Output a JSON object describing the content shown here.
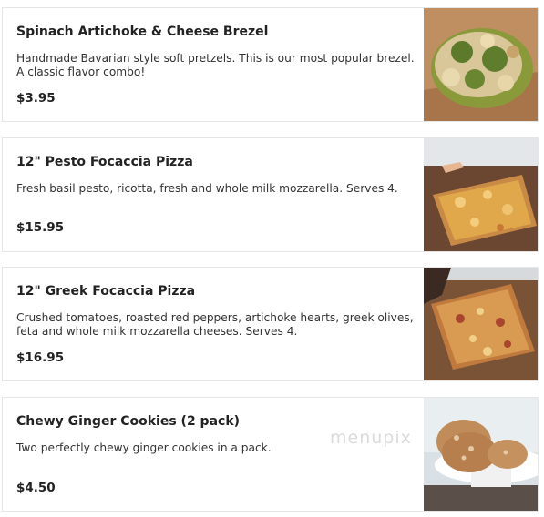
{
  "menu_items": [
    {
      "name": "Spinach Artichoke & Cheese Brezel",
      "description": "Handmade Bavarian style soft pretzels. This is our most popular brezel. A classic flavor combo!",
      "price": "$3.95",
      "image_icon": "pretzel-photo"
    },
    {
      "name": "12\" Pesto Focaccia Pizza",
      "description": "Fresh basil pesto, ricotta, fresh and whole milk mozzarella. Serves 4.",
      "price": "$15.95",
      "image_icon": "pizza-photo"
    },
    {
      "name": "12\" Greek Focaccia Pizza",
      "description": "Crushed tomatoes, roasted red peppers, artichoke hearts, greek olives, feta and whole milk mozzarella cheeses. Serves 4.",
      "price": "$16.95",
      "image_icon": "pizza-photo"
    },
    {
      "name": "Chewy Ginger Cookies (2 pack)",
      "description": "Two perfectly chewy ginger cookies in a pack.",
      "price": "$4.50",
      "image_icon": "cookies-photo"
    }
  ],
  "watermark": "menupix",
  "colors": {
    "border": "#e6e6e6",
    "text": "#222222"
  }
}
